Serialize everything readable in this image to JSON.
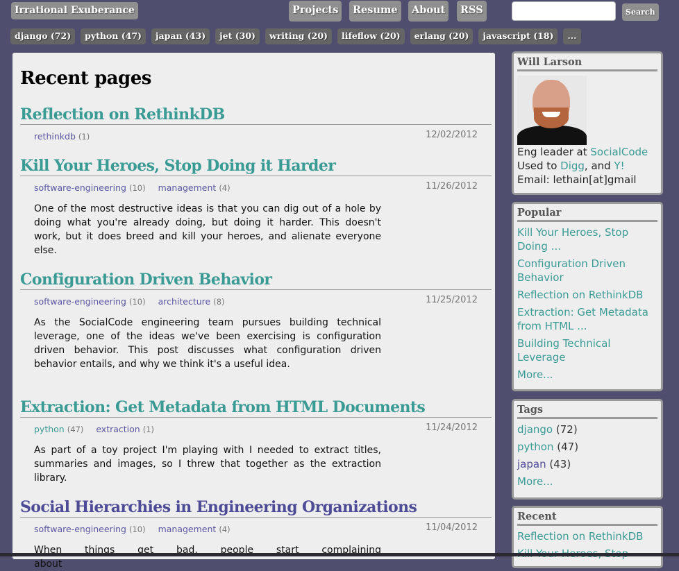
{
  "header": {
    "brand": "Irrational Exuberance",
    "nav": [
      "Projects",
      "Resume",
      "About",
      "RSS"
    ],
    "search": {
      "value": "",
      "placeholder": "",
      "button": "Search"
    }
  },
  "tagbar": [
    "django (72)",
    "python (47)",
    "japan (43)",
    "jet (30)",
    "writing (20)",
    "lifeflow (20)",
    "erlang (20)",
    "javascript (18)",
    "..."
  ],
  "main": {
    "heading": "Recent pages",
    "posts": [
      {
        "title": "Reflection on RethinkDB",
        "tags": [
          {
            "name": "rethinkdb",
            "count": "(1)"
          }
        ],
        "date": "12/02/2012",
        "summary": ""
      },
      {
        "title": "Kill Your Heroes, Stop Doing it Harder",
        "tags": [
          {
            "name": "software-engineering",
            "count": "(10)"
          },
          {
            "name": "management",
            "count": "(4)"
          }
        ],
        "date": "11/26/2012",
        "summary": "One of the most destructive ideas is that you can dig out of a hole by doing what you're already doing, but doing it harder. This doesn't work, but it does breed and kill your heroes, and alienate everyone else."
      },
      {
        "title": "Configuration Driven Behavior",
        "tags": [
          {
            "name": "software-engineering",
            "count": "(10)"
          },
          {
            "name": "architecture",
            "count": "(8)"
          }
        ],
        "date": "11/25/2012",
        "summary": "As the SocialCode engineering team pursues building technical leverage, one of the ideas we've been exercising is configuration driven behavior. This post discusses what configuration driven behavior entails, and why we think it's a useful idea."
      },
      {
        "title": "Extraction: Get Metadata from HTML Documents",
        "tags": [
          {
            "name": "python",
            "count": "(47)"
          },
          {
            "name": "extraction",
            "count": "(1)"
          }
        ],
        "date": "11/24/2012",
        "summary": "As part of a toy project I'm playing with I needed to extract titles, summaries and images, so I threw that together as the extraction library."
      },
      {
        "title": "Social Hierarchies in Engineering Organizations",
        "tags": [
          {
            "name": "software-engineering",
            "count": "(10)"
          },
          {
            "name": "management",
            "count": "(4)"
          }
        ],
        "date": "11/04/2012",
        "summary": "When things get bad, people start complaining about"
      }
    ]
  },
  "sidebar": {
    "author": {
      "name": "Will Larson",
      "line1_prefix": "Eng leader at ",
      "line1_link": "SocialCode",
      "line2_prefix": "Used to ",
      "line2_link1": "Digg",
      "line2_mid": ", and ",
      "line2_link2": "Y!",
      "line3": "Email: lethain[at]gmail"
    },
    "popular": {
      "title": "Popular",
      "items": [
        "Kill Your Heroes, Stop Doing ...",
        "Configuration Driven Behavior",
        "Reflection on RethinkDB",
        "Extraction: Get Metadata from HTML ...",
        "Building Technical Leverage"
      ],
      "more": "More..."
    },
    "tags": {
      "title": "Tags",
      "items": [
        {
          "name": "django",
          "count": "(72)"
        },
        {
          "name": "python",
          "count": "(47)"
        },
        {
          "name": "japan",
          "count": "(43)"
        }
      ],
      "more": "More..."
    },
    "recent": {
      "title": "Recent",
      "items": [
        "Reflection on RethinkDB",
        "Kill Your Heroes, Stop"
      ]
    }
  }
}
